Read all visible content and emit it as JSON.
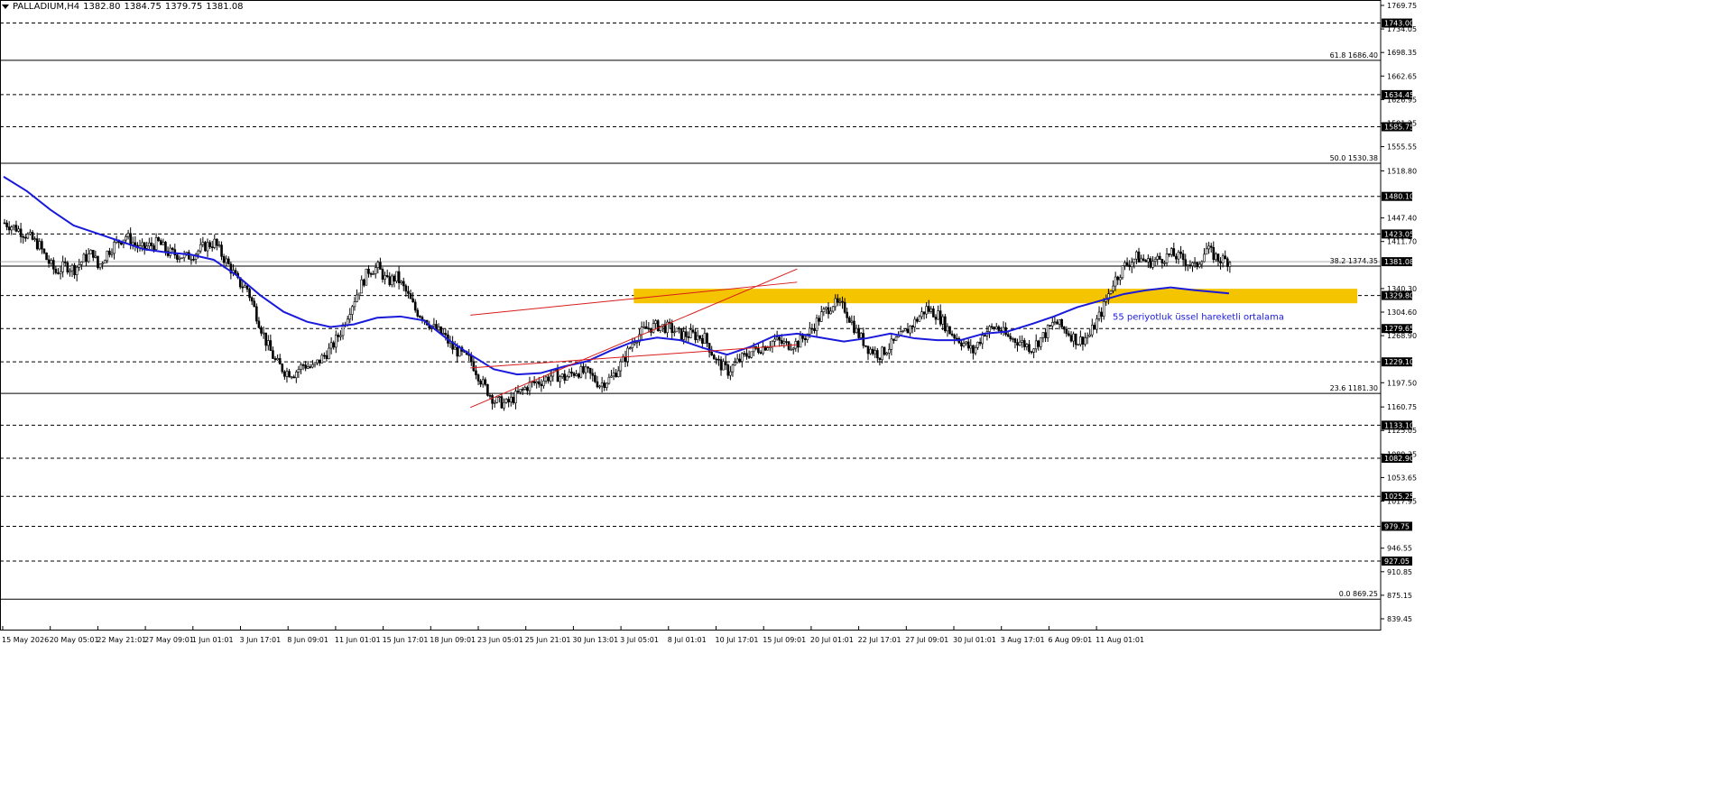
{
  "header": {
    "symbol": "PALLADIUM,H4",
    "open": "1382.80",
    "high": "1384.75",
    "low": "1379.75",
    "close": "1381.08"
  },
  "colors": {
    "candle": "#000000",
    "ema": "#1a1adb",
    "channel": "#d81b1b",
    "zone": "#f5c400",
    "annotation": "#1a1adb",
    "level_box": "#000000"
  },
  "chart_data": {
    "type": "candlestick",
    "ylim": [
      839.45,
      1769.75
    ],
    "price_ticks": [
      "1769.75",
      "1734.05",
      "1698.35",
      "1662.65",
      "1626.95",
      "1591.25",
      "1555.55",
      "1518.80",
      "1447.40",
      "1411.70",
      "1340.30",
      "1304.60",
      "1268.90",
      "1197.50",
      "1160.75",
      "1125.05",
      "1089.35",
      "1053.65",
      "1017.95",
      "946.55",
      "910.85",
      "875.15",
      "839.45"
    ],
    "levels": [
      {
        "label": "1743.00",
        "value": 1743.0
      },
      {
        "label": "1634.45",
        "value": 1634.45
      },
      {
        "label": "1585.75",
        "value": 1585.75
      },
      {
        "label": "1480.10",
        "value": 1480.1
      },
      {
        "label": "1423.05",
        "value": 1423.05
      },
      {
        "label": "1329.80",
        "value": 1329.8
      },
      {
        "label": "1279.65",
        "value": 1279.65
      },
      {
        "label": "1229.10",
        "value": 1229.1
      },
      {
        "label": "1133.10",
        "value": 1133.1
      },
      {
        "label": "1082.90",
        "value": 1082.9
      },
      {
        "label": "1025.25",
        "value": 1025.25
      },
      {
        "label": "979.75",
        "value": 979.75
      },
      {
        "label": "927.05",
        "value": 927.05
      }
    ],
    "fibonacci": [
      {
        "label": "61.8 1686.40",
        "value": 1686.4
      },
      {
        "label": "50.0 1530.38",
        "value": 1530.38
      },
      {
        "label": "38.2 1374.35",
        "value": 1374.35
      },
      {
        "label": "23.6 1181.30",
        "value": 1181.3
      },
      {
        "label": "0.0 869.25",
        "value": 869.25
      }
    ],
    "current_price": {
      "label": "1381.08",
      "value": 1381.08
    },
    "x_labels": [
      "15 May 2026",
      "20 May 05:01",
      "22 May 21:01",
      "27 May 09:01",
      "1 Jun 01:01",
      "3 Jun 17:01",
      "8 Jun 09:01",
      "11 Jun 01:01",
      "15 Jun 17:01",
      "18 Jun 09:01",
      "23 Jun 05:01",
      "25 Jun 21:01",
      "30 Jun 13:01",
      "3 Jul 05:01",
      "8 Jul 01:01",
      "10 Jul 17:01",
      "15 Jul 09:01",
      "20 Jul 01:01",
      "22 Jul 17:01",
      "27 Jul 09:01",
      "30 Jul 01:01",
      "3 Aug 17:01",
      "6 Aug 09:01",
      "11 Aug 01:01"
    ],
    "close_path": [
      [
        0,
        1440
      ],
      [
        5,
        1432
      ],
      [
        10,
        1420
      ],
      [
        15,
        1405
      ],
      [
        18,
        1385
      ],
      [
        22,
        1365
      ],
      [
        26,
        1375
      ],
      [
        30,
        1370
      ],
      [
        34,
        1385
      ],
      [
        38,
        1395
      ],
      [
        40,
        1372
      ],
      [
        44,
        1395
      ],
      [
        48,
        1410
      ],
      [
        52,
        1420
      ],
      [
        55,
        1410
      ],
      [
        58,
        1400
      ],
      [
        62,
        1405
      ],
      [
        66,
        1410
      ],
      [
        70,
        1395
      ],
      [
        74,
        1392
      ],
      [
        78,
        1388
      ],
      [
        82,
        1395
      ],
      [
        86,
        1405
      ],
      [
        90,
        1410
      ],
      [
        93,
        1392
      ],
      [
        97,
        1370
      ],
      [
        100,
        1350
      ],
      [
        104,
        1340
      ],
      [
        108,
        1300
      ],
      [
        112,
        1260
      ],
      [
        116,
        1230
      ],
      [
        120,
        1215
      ],
      [
        124,
        1212
      ],
      [
        128,
        1225
      ],
      [
        132,
        1220
      ],
      [
        136,
        1235
      ],
      [
        140,
        1250
      ],
      [
        144,
        1275
      ],
      [
        148,
        1310
      ],
      [
        152,
        1340
      ],
      [
        156,
        1368
      ],
      [
        160,
        1372
      ],
      [
        164,
        1350
      ],
      [
        168,
        1358
      ],
      [
        172,
        1335
      ],
      [
        176,
        1308
      ],
      [
        180,
        1295
      ],
      [
        184,
        1280
      ],
      [
        188,
        1270
      ],
      [
        192,
        1250
      ],
      [
        196,
        1240
      ],
      [
        200,
        1230
      ],
      [
        205,
        1195
      ],
      [
        210,
        1170
      ],
      [
        215,
        1165
      ],
      [
        220,
        1180
      ],
      [
        225,
        1195
      ],
      [
        230,
        1200
      ],
      [
        235,
        1210
      ],
      [
        240,
        1205
      ],
      [
        245,
        1215
      ],
      [
        250,
        1212
      ],
      [
        255,
        1195
      ],
      [
        260,
        1205
      ],
      [
        265,
        1230
      ],
      [
        270,
        1265
      ],
      [
        275,
        1280
      ],
      [
        280,
        1284
      ],
      [
        285,
        1280
      ],
      [
        290,
        1270
      ],
      [
        295,
        1270
      ],
      [
        300,
        1265
      ],
      [
        305,
        1230
      ],
      [
        310,
        1215
      ],
      [
        315,
        1232
      ],
      [
        320,
        1245
      ],
      [
        325,
        1252
      ],
      [
        330,
        1262
      ],
      [
        335,
        1255
      ],
      [
        340,
        1258
      ],
      [
        345,
        1275
      ],
      [
        350,
        1300
      ],
      [
        355,
        1318
      ],
      [
        360,
        1310
      ],
      [
        365,
        1275
      ],
      [
        370,
        1250
      ],
      [
        375,
        1240
      ],
      [
        380,
        1255
      ],
      [
        385,
        1270
      ],
      [
        390,
        1290
      ],
      [
        395,
        1310
      ],
      [
        400,
        1300
      ],
      [
        405,
        1275
      ],
      [
        410,
        1260
      ],
      [
        415,
        1245
      ],
      [
        420,
        1275
      ],
      [
        425,
        1282
      ],
      [
        430,
        1266
      ],
      [
        435,
        1260
      ],
      [
        440,
        1250
      ],
      [
        445,
        1268
      ],
      [
        450,
        1290
      ],
      [
        455,
        1276
      ],
      [
        460,
        1260
      ],
      [
        465,
        1270
      ],
      [
        470,
        1305
      ],
      [
        475,
        1350
      ],
      [
        480,
        1375
      ],
      [
        485,
        1388
      ],
      [
        490,
        1380
      ],
      [
        495,
        1385
      ],
      [
        500,
        1392
      ],
      [
        505,
        1385
      ],
      [
        510,
        1372
      ],
      [
        515,
        1400
      ],
      [
        520,
        1385
      ],
      [
        525,
        1382
      ]
    ],
    "ema55": [
      [
        0,
        1510
      ],
      [
        10,
        1488
      ],
      [
        20,
        1460
      ],
      [
        30,
        1436
      ],
      [
        40,
        1424
      ],
      [
        50,
        1412
      ],
      [
        60,
        1400
      ],
      [
        70,
        1395
      ],
      [
        80,
        1392
      ],
      [
        90,
        1384
      ],
      [
        100,
        1360
      ],
      [
        110,
        1330
      ],
      [
        120,
        1305
      ],
      [
        130,
        1290
      ],
      [
        140,
        1282
      ],
      [
        150,
        1286
      ],
      [
        160,
        1296
      ],
      [
        170,
        1298
      ],
      [
        180,
        1292
      ],
      [
        190,
        1264
      ],
      [
        200,
        1240
      ],
      [
        210,
        1218
      ],
      [
        220,
        1210
      ],
      [
        230,
        1212
      ],
      [
        240,
        1222
      ],
      [
        250,
        1230
      ],
      [
        260,
        1246
      ],
      [
        270,
        1260
      ],
      [
        280,
        1266
      ],
      [
        290,
        1262
      ],
      [
        300,
        1250
      ],
      [
        310,
        1240
      ],
      [
        320,
        1252
      ],
      [
        330,
        1268
      ],
      [
        340,
        1272
      ],
      [
        350,
        1266
      ],
      [
        360,
        1260
      ],
      [
        370,
        1265
      ],
      [
        380,
        1272
      ],
      [
        390,
        1265
      ],
      [
        400,
        1262
      ],
      [
        410,
        1262
      ],
      [
        420,
        1272
      ],
      [
        430,
        1275
      ],
      [
        440,
        1286
      ],
      [
        450,
        1298
      ],
      [
        460,
        1312
      ],
      [
        470,
        1322
      ],
      [
        480,
        1332
      ],
      [
        490,
        1338
      ],
      [
        500,
        1342
      ],
      [
        510,
        1338
      ],
      [
        525,
        1333
      ]
    ],
    "channel": [
      {
        "from": [
          200,
          1160
        ],
        "to": [
          340,
          1370
        ]
      },
      {
        "from": [
          200,
          1300
        ],
        "to": [
          340,
          1350
        ]
      },
      {
        "from": [
          200,
          1220
        ],
        "to": [
          340,
          1255
        ]
      }
    ],
    "zone": {
      "from_bar": 270,
      "to_bar": 580,
      "low": 1318,
      "high": 1340
    },
    "annotation": "55 periyotluk üssel hareketli ortalama"
  }
}
